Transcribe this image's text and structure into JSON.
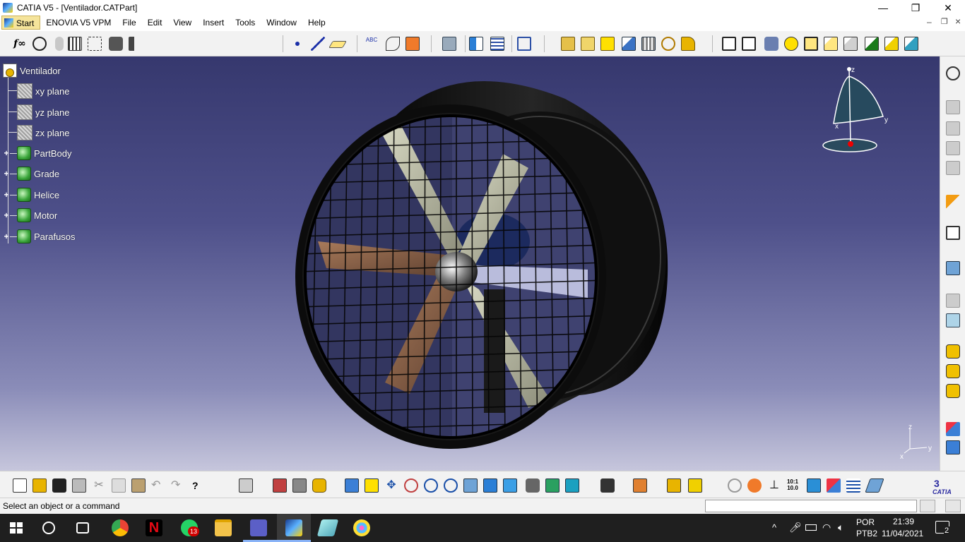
{
  "window": {
    "title": "CATIA V5 - [Ventilador.CATPart]",
    "controls": {
      "minimize": "—",
      "maximize": "❐",
      "close": "✕"
    }
  },
  "menubar": {
    "items": [
      "Start",
      "ENOVIA V5 VPM",
      "File",
      "Edit",
      "View",
      "Insert",
      "Tools",
      "Window",
      "Help"
    ],
    "mdi_controls": {
      "minimize": "–",
      "restore": "❐",
      "close": "×"
    }
  },
  "spec_tree": {
    "root": "Ventilador",
    "planes": [
      "xy plane",
      "yz plane",
      "zx plane"
    ],
    "bodies": [
      "PartBody",
      "Grade",
      "Helice",
      "Motor",
      "Parafusos"
    ]
  },
  "compass": {
    "labels": {
      "z": "z",
      "x": "x",
      "y": "y"
    }
  },
  "axis_triad": {
    "labels": {
      "z": "z",
      "x": "x",
      "y": "y"
    }
  },
  "statusbar": {
    "message": "Select an object or a command",
    "command_input": ""
  },
  "taskbar": {
    "whatsapp_badge": "13",
    "language_line1": "POR",
    "language_line2": "PTB2",
    "time": "21:39",
    "date": "11/04/2021",
    "notifications": "2"
  },
  "colors": {
    "viewport_top": "#36386e",
    "viewport_bottom": "#c6c6dc",
    "toolbar_bg": "#f2f2f2",
    "taskbar_bg": "#1f1f1f"
  }
}
